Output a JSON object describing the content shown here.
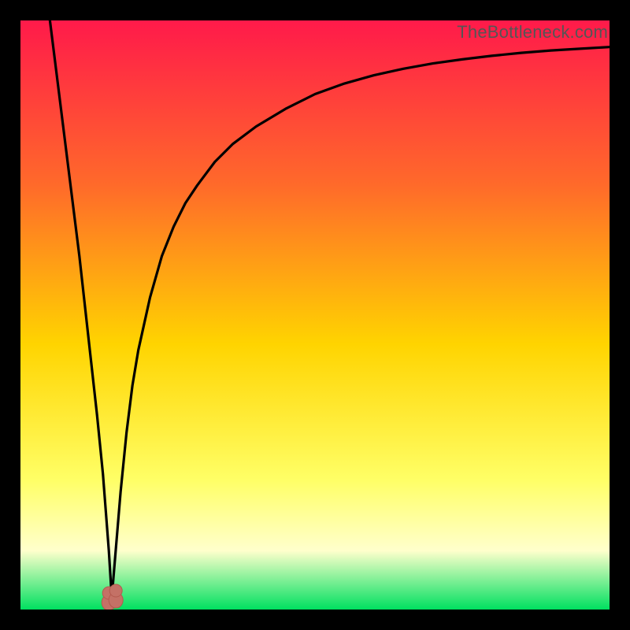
{
  "watermark": "TheBottleneck.com",
  "colors": {
    "gradient_top": "#ff1a4a",
    "gradient_mid_upper": "#ff6a2a",
    "gradient_mid": "#ffd400",
    "gradient_mid_lower": "#ffff66",
    "gradient_low": "#ffffcc",
    "gradient_bottom": "#00e060",
    "curve": "#000000",
    "marker_fill": "#c47166",
    "marker_stroke": "#b35a4e",
    "frame_bg": "#ffffff",
    "page_bg": "#000000"
  },
  "chart_data": {
    "type": "line",
    "title": "",
    "xlabel": "",
    "ylabel": "",
    "xlim": [
      0,
      100
    ],
    "ylim": [
      0,
      100
    ],
    "optimum_x": 15.5,
    "series": [
      {
        "name": "bottleneck-curve",
        "x": [
          5,
          8,
          10,
          12,
          13,
          14,
          15,
          15.5,
          16,
          17,
          18,
          19,
          20,
          22,
          24,
          26,
          28,
          30,
          33,
          36,
          40,
          45,
          50,
          55,
          60,
          65,
          70,
          75,
          80,
          85,
          90,
          95,
          100
        ],
        "y": [
          100,
          76,
          60,
          42,
          33,
          23,
          10,
          2,
          8,
          20,
          30,
          38,
          44,
          53,
          60,
          65,
          69,
          72,
          76,
          79,
          82,
          85,
          87.5,
          89.3,
          90.7,
          91.8,
          92.7,
          93.4,
          94,
          94.5,
          94.9,
          95.2,
          95.5
        ]
      }
    ],
    "markers": [
      {
        "name": "optimum-point-a",
        "x": 15.0,
        "y": 2.0
      },
      {
        "name": "optimum-point-b",
        "x": 16.2,
        "y": 2.4
      }
    ]
  }
}
